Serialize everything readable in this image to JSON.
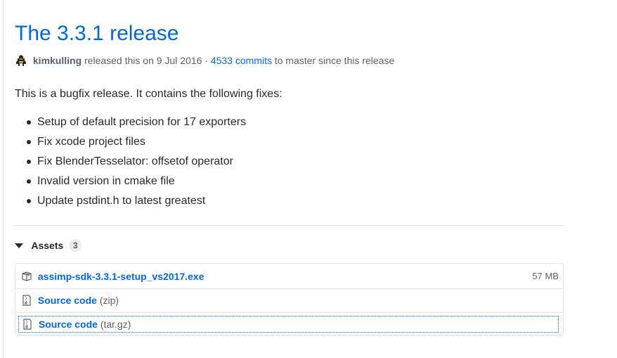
{
  "release": {
    "title": "The 3.3.1 release",
    "author": "kimkulling",
    "released_text": "released this on",
    "date": "9 Jul 2016",
    "separator": "·",
    "commits": "4533 commits",
    "commits_suffix": "to master since this release"
  },
  "body": {
    "intro": "This is a bugfix release. It contains the following fixes:",
    "fixes": [
      "Setup of default precision for 17 exporters",
      "Fix xcode project files",
      "Fix BlenderTesselator: offsetof operator",
      "Invalid version in cmake file",
      "Update pstdint.h to latest greatest"
    ]
  },
  "assets": {
    "label": "Assets",
    "count": "3",
    "items": [
      {
        "icon": "package-icon",
        "name": "assimp-sdk-3.3.1-setup_vs2017.exe",
        "suffix": "",
        "size": "57 MB"
      },
      {
        "icon": "file-zip-icon",
        "name": "Source code",
        "suffix": "(zip)",
        "size": ""
      },
      {
        "icon": "file-zip-icon",
        "name": "Source code",
        "suffix": "(tar.gz)",
        "size": ""
      }
    ]
  },
  "colors": {
    "link": "#0366d6",
    "text": "#24292e",
    "muted": "#586069",
    "border": "#e1e4e8"
  }
}
